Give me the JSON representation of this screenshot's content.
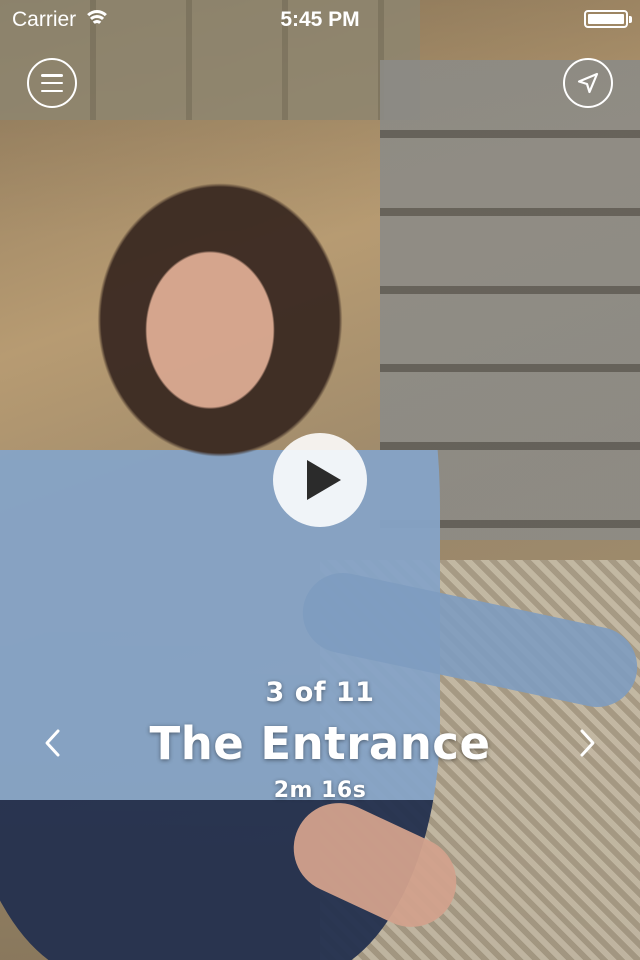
{
  "status_bar": {
    "carrier": "Carrier",
    "time": "5:45 PM",
    "battery_level": 1.0
  },
  "top_bar": {
    "menu_icon": "hamburger-menu-icon",
    "location_icon": "location-arrow-icon"
  },
  "player": {
    "play_icon": "play-icon"
  },
  "tour_stop": {
    "counter": "3 of 11",
    "title": "The Entrance",
    "duration": "2m 16s"
  },
  "navigation": {
    "prev_icon": "chevron-left-icon",
    "next_icon": "chevron-right-icon"
  },
  "colors": {
    "overlay_text": "#ffffff",
    "play_button_bg": "#ffffff",
    "play_triangle": "#2b2b2b"
  }
}
